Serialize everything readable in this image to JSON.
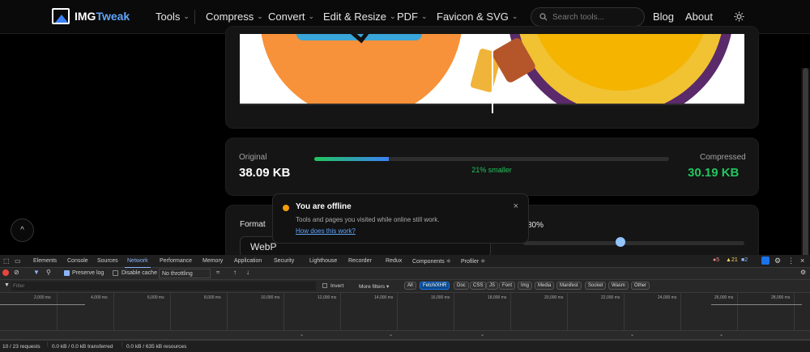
{
  "nav": {
    "logo_main": "IMG",
    "logo_accent": "Tweak",
    "items": [
      {
        "label": "Tools",
        "dropdown": true
      },
      {
        "label": "Compress",
        "dropdown": true
      },
      {
        "label": "Convert",
        "dropdown": true
      },
      {
        "label": "Edit & Resize",
        "dropdown": true
      },
      {
        "label": "PDF",
        "dropdown": true
      },
      {
        "label": "Favicon & SVG",
        "dropdown": true
      }
    ],
    "search_placeholder": "Search tools...",
    "blog": "Blog",
    "about": "About"
  },
  "stats": {
    "original_label": "Original",
    "original_size": "38.09 KB",
    "reduction": "21% smaller",
    "compressed_label": "Compressed",
    "compressed_size": "30.19 KB",
    "progress_fraction": 0.21
  },
  "toast": {
    "title": "You are offline",
    "message": "Tools and pages you visited while online still work.",
    "link": "How does this work?"
  },
  "settings": {
    "format_label": "Format",
    "format_value": "WebP",
    "quality_label_partial": "80%",
    "quality_fraction": 0.44
  },
  "devtools": {
    "tabs": [
      "Elements",
      "Console",
      "Sources",
      "Network",
      "Performance",
      "Memory",
      "Application",
      "Security",
      "Lighthouse",
      "Recorder",
      "Redux",
      "Components ⚛",
      "Profiler ⚛"
    ],
    "active_tab": "Network",
    "errors": "5",
    "warnings": "21",
    "messages": "2",
    "preserve_log": "Preserve log",
    "disable_cache": "Disable cache",
    "throttling": "No throttling",
    "filter_placeholder": "Filter",
    "invert": "Invert",
    "more_filters": "More filters ▾",
    "filter_chips": [
      "All",
      "Fetch/XHR",
      "Doc",
      "CSS",
      "JS",
      "Font",
      "Img",
      "Media",
      "Manifest",
      "Socket",
      "Wasm",
      "Other"
    ],
    "selected_chip": "Fetch/XHR",
    "ticks": [
      "2,000 ms",
      "4,000 ms",
      "6,000 ms",
      "8,000 ms",
      "10,000 ms",
      "12,000 ms",
      "14,000 ms",
      "16,000 ms",
      "18,000 ms",
      "20,000 ms",
      "22,000 ms",
      "24,000 ms",
      "26,000 ms",
      "28,000 ms"
    ],
    "status_requests": "10 / 23 requests",
    "status_transferred": "0.0 kB / 0.0 kB transferred",
    "status_resources": "0.0 kB / 635 kB resources"
  }
}
